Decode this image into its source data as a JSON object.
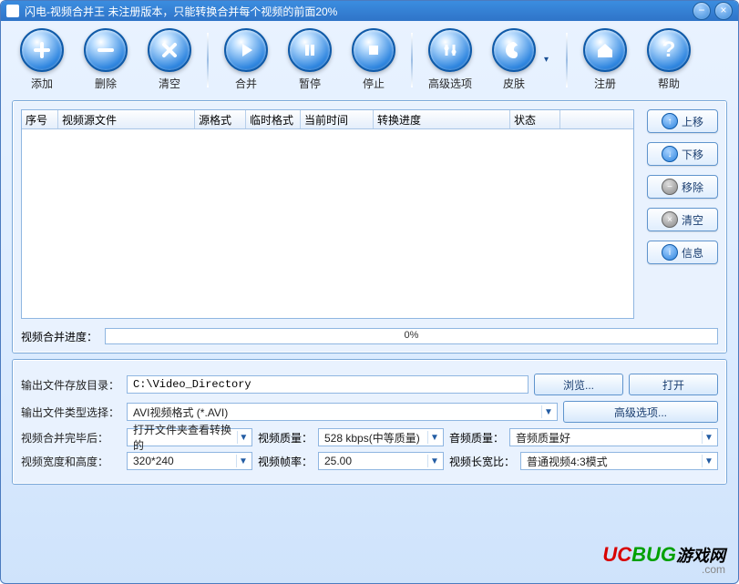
{
  "titlebar": {
    "title": "闪电-视频合并王 未注册版本，只能转换合并每个视频的前面20%"
  },
  "toolbar": {
    "add": "添加",
    "delete": "删除",
    "clear": "清空",
    "merge": "合并",
    "pause": "暂停",
    "stop": "停止",
    "adv_options": "高级选项",
    "skin": "皮肤",
    "register": "注册",
    "help": "帮助"
  },
  "table": {
    "headers": {
      "index": "序号",
      "source_file": "视频源文件",
      "source_format": "源格式",
      "temp_format": "临时格式",
      "current_time": "当前时间",
      "progress": "转换进度",
      "status": "状态"
    }
  },
  "side_buttons": {
    "move_up": "上移",
    "move_down": "下移",
    "remove": "移除",
    "clear": "清空",
    "info": "信息"
  },
  "merge_progress": {
    "label": "视频合并进度：",
    "percent_text": "0%",
    "percent_value": 0
  },
  "output": {
    "dir_label": "输出文件存放目录：",
    "dir_value": "C:\\Video_Directory",
    "browse": "浏览...",
    "open": "打开",
    "type_label": "输出文件类型选择：",
    "type_value": "AVI视频格式 (*.AVI)",
    "adv_options": "高级选项...",
    "after_merge_label": "视频合并完毕后：",
    "after_merge_value": "打开文件夹查看转换的",
    "video_quality_label": "视频质量：",
    "video_quality_value": "528 kbps(中等质量)",
    "audio_quality_label": "音频质量：",
    "audio_quality_value": "音频质量好",
    "wh_label": "视频宽度和高度：",
    "wh_value": "320*240",
    "fps_label": "视频帧率：",
    "fps_value": "25.00",
    "aspect_label": "视频长宽比：",
    "aspect_value": "普通视频4:3模式"
  },
  "watermark": {
    "part1": "UC",
    "part2": "BUG",
    "part3": "游戏网",
    "part4": ".com"
  }
}
